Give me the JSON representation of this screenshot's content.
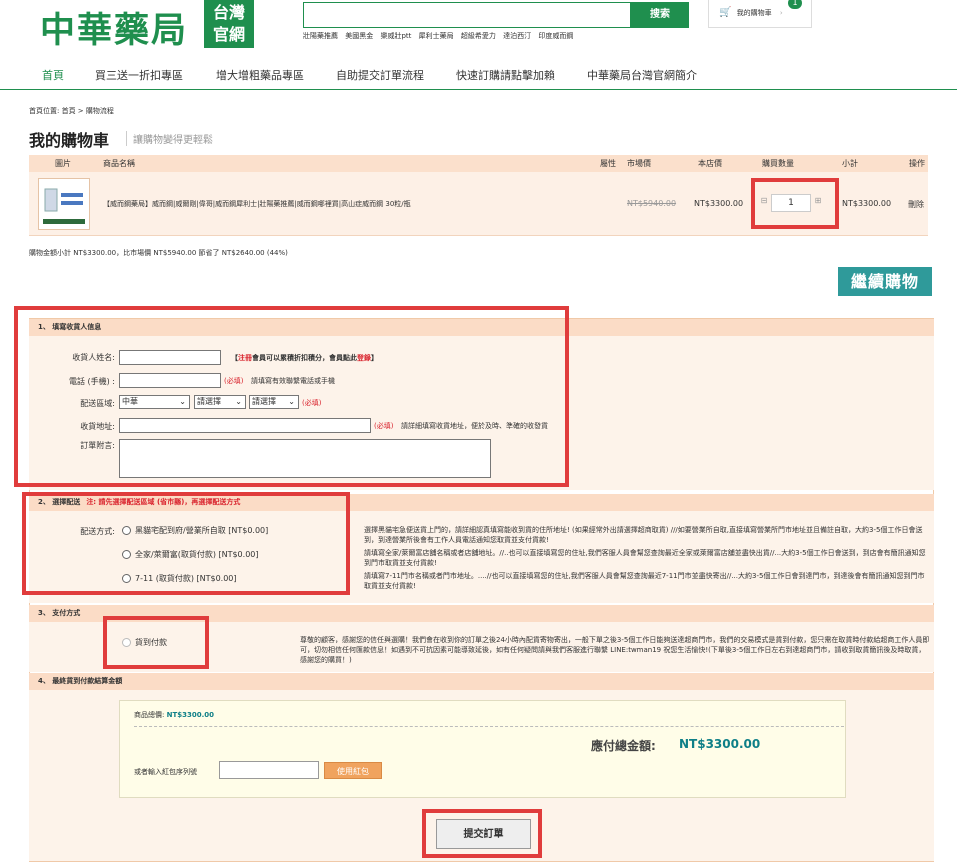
{
  "header": {
    "logo_main": "中華藥局",
    "logo_badge": [
      "台灣",
      "官網"
    ],
    "search_placeholder": "",
    "search_button": "搜索",
    "hotwords": [
      "壯陽藥推薦",
      "美國黑金",
      "樂威壯ptt",
      "犀利士藥局",
      "超級希愛力",
      "達泊西汀",
      "印度威而鋼"
    ],
    "cart_label": "我的購物車",
    "cart_count": "1"
  },
  "nav": [
    "首頁",
    "買三送一折扣專區",
    "增大增粗藥品專區",
    "自助提交訂單流程",
    "快速訂購請點擊加賴",
    "中華藥局台灣官網簡介"
  ],
  "breadcrumb": "首頁位置: 首頁 > 購物流程",
  "cart": {
    "title": "我的購物車",
    "subtitle": "讓購物變得更輕鬆",
    "columns": [
      "圖片",
      "商品名稱",
      "屬性",
      "市場價",
      "本店價",
      "購買數量",
      "小計",
      "操作"
    ],
    "item": {
      "name": "【威而鋼藥局】威而鋼|威爾剛|偉哥|威而鋼犀利士|壯陽藥推薦|威而鋼哪裡買|高山症威而鋼 30粒/瓶",
      "market_price": "NT$5940.00",
      "price": "NT$3300.00",
      "qty": "1",
      "qty_minus": "⊟",
      "qty_plus": "⊞",
      "subtotal": "NT$3300.00",
      "delete": "刪除"
    },
    "summary": "購物金額小計 NT$3300.00，比市場價 NT$5940.00 節省了 NT$2640.00 (44%)",
    "continue_button": "繼續購物"
  },
  "section1": {
    "title": "1、 填寫收貨人信息",
    "name_label": "收貨人姓名:",
    "name_note_a": "【",
    "name_note_b": "注冊",
    "name_note_c": "會員可以累積折扣積分，會員點此",
    "name_note_d": "登錄",
    "name_note_e": "】",
    "phone_label": "電話 (手機) :",
    "required": "(必填)",
    "phone_note": "請填寫有效聯繫電話或手機",
    "region_label": "配送區域:",
    "region_options": [
      "中華",
      "請選擇",
      "請選擇"
    ],
    "address_label": "收貨地址:",
    "address_note": "請詳細填寫收貨地址，便於及時、準確的收發貨",
    "message_label": "訂單附言:"
  },
  "section2": {
    "title": "2、 選擇配送",
    "title_note": "注: 請先選擇配送區域 (省市縣)，再選擇配送方式",
    "method_label": "配送方式:",
    "methods": [
      "黑貓宅配到府/營業所自取 [NT$0.00]",
      "全家/萊爾富(取貨付款) [NT$0.00]",
      "7-11 (取貨付款) [NT$0.00]"
    ],
    "desc": [
      "選擇黑貓宅急便送貨上門的，請詳細認真填寫能收到貨的住所地址! (如果經常外出請選擇超商取貨) ///如要營業所自取,直接填寫營業所門市地址並且備註自取，大約3-5個工作日會送到，到達營業所後會有工作人員電話通知您取貨並支付貨款!",
      "請填寫全家/萊爾富店舖名稱或者店舖地址。//..也可以直接填寫您的住址,我們客服人員會幫您查詢最近全家或萊爾富店舖並盡快出貨//...大約3-5個工作日會送到，到店會有簡訊通知您到門市取貨並支付貨款!",
      "請填寫7-11門市名稱或者門市地址。....//也可以直接填寫您的住址,我們客服人員會幫您查詢最近7-11門市並盡快寄出//...大約3-5個工作日會到達門市，到達後會有簡訊通知您到門市取貨並支付貨款!"
    ]
  },
  "section3": {
    "title": "3、 支付方式",
    "method": "貨到付款",
    "desc": "尊敬的顧客，感謝您的信任與選購！我們會在收到你的訂單之後24小時內配貨寄物寄出，一般下單之後3-5個工作日能夠送達超商門市，我們的交易模式是貨到付款，您只需在取貨時付款給超商工作人員即可，切勿相信任何匯款信息！如遇到不可抗因素可能導致延後，如有任何疑問請與我們客服進行聯繫 LINE:twman19 祝您生活愉快!(下單後3-5個工作日左右到達超商門市，請收到取貨簡訊後及時取貨，感謝您的購買！)"
  },
  "section4": {
    "title": "4、 最終貨到付款結算金額",
    "goods_label": "商品總價:",
    "goods_value": "NT$3300.00",
    "total_label": "應付總金額:",
    "total_value": "NT$3300.00",
    "coupon_label": "或者輸入紅包序列號",
    "coupon_button": "使用紅包",
    "submit_button": "提交訂單"
  },
  "colors": {
    "brand_green": "#1f8f4e",
    "teal": "#0e7f87",
    "highlight_red": "#e03c3c"
  }
}
